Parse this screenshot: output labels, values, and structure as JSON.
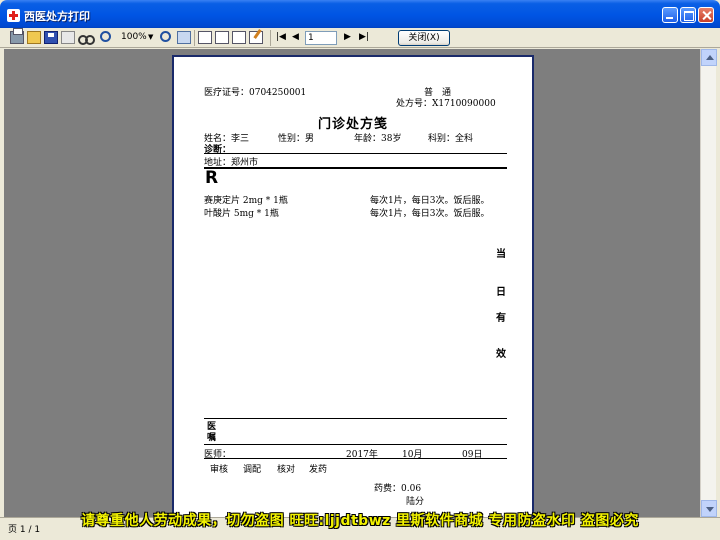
{
  "window": {
    "title": "西医处方打印"
  },
  "toolbar": {
    "zoom": "100%",
    "page_input": "1",
    "close_label": "关闭(X)"
  },
  "prescription": {
    "cert_no": "医疗证号：0704250001",
    "type": "普　通",
    "rx_no": "处方号：X1710090000",
    "title": "门诊处方笺",
    "name": "姓名：李三",
    "gender": "性别：男",
    "age": "年龄：38岁",
    "dept": "科别：全科",
    "diagnosis": "诊断：",
    "address": "地址：郑州市",
    "rx_symbol": "R",
    "items": [
      {
        "drug": "赛庚定片 2mg * 1瓶",
        "usage": "每次1片，每日3次。饭后服。"
      },
      {
        "drug": "叶酸片 5mg * 1瓶",
        "usage": "每次1片，每日3次。饭后服。"
      }
    ],
    "side_notes": [
      "当",
      "日",
      "有",
      "效"
    ],
    "advice_label": "医嘱",
    "doctor": "医师：",
    "year": "2017年",
    "month": "10月",
    "day": "09日",
    "review": "审核",
    "dispense": "调配",
    "check": "核对",
    "issue": "发药",
    "fee": "药费：0.06",
    "pharmacist": "陆分"
  },
  "status": {
    "page": "页 1 / 1"
  },
  "watermark": "请尊重他人劳动成果，切勿盗图 旺旺:ljjdtbwz 里斯软件商城 专用防盗水印 盗图必究"
}
